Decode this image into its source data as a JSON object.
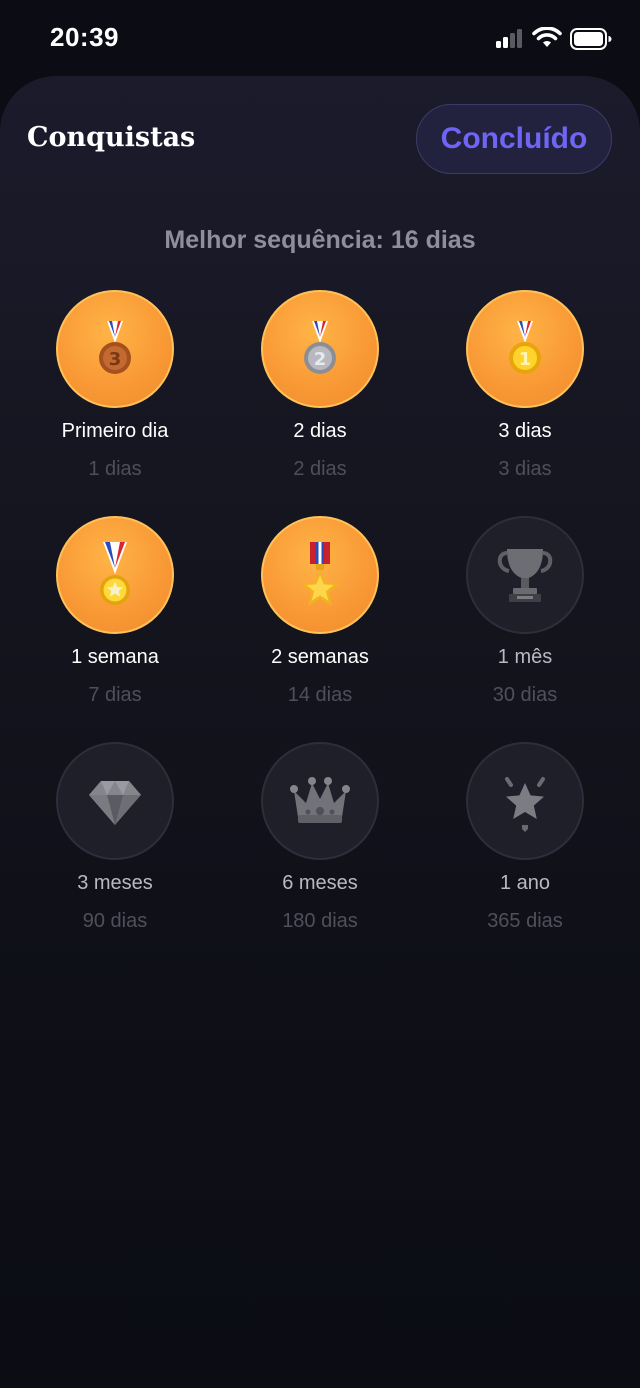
{
  "status_bar": {
    "time": "20:39",
    "signal_icon": "cellular-signal-icon",
    "wifi_icon": "wifi-icon",
    "battery_icon": "battery-icon"
  },
  "header": {
    "title": "Conquistas",
    "done_label": "Concluído"
  },
  "best_streak": "Melhor sequência: 16 dias",
  "colors": {
    "accent": "#6f65f2",
    "unlocked_badge": "#f99a36",
    "locked_badge": "#1f1f2a"
  },
  "achievements": [
    {
      "label": "Primeiro dia",
      "days": "1 dias",
      "unlocked": true,
      "icon": "bronze-medal-3-icon"
    },
    {
      "label": "2 dias",
      "days": "2 dias",
      "unlocked": true,
      "icon": "silver-medal-2-icon"
    },
    {
      "label": "3 dias",
      "days": "3 dias",
      "unlocked": true,
      "icon": "gold-medal-1-icon"
    },
    {
      "label": "1 semana",
      "days": "7 dias",
      "unlocked": true,
      "icon": "star-medal-icon"
    },
    {
      "label": "2 semanas",
      "days": "14 dias",
      "unlocked": true,
      "icon": "military-medal-icon"
    },
    {
      "label": "1 mês",
      "days": "30 dias",
      "unlocked": false,
      "icon": "trophy-icon"
    },
    {
      "label": "3 meses",
      "days": "90 dias",
      "unlocked": false,
      "icon": "diamond-icon"
    },
    {
      "label": "6 meses",
      "days": "180 dias",
      "unlocked": false,
      "icon": "crown-icon"
    },
    {
      "label": "1 ano",
      "days": "365 dias",
      "unlocked": false,
      "icon": "glowing-star-icon"
    }
  ]
}
